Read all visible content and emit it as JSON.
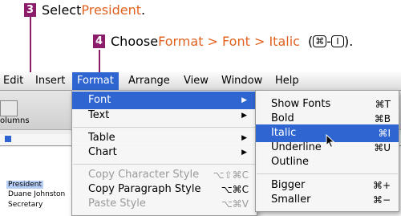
{
  "steps": {
    "step3": {
      "number": "3",
      "text": "Select ",
      "target": "President",
      "end": "."
    },
    "step4": {
      "number": "4",
      "text": "Choose ",
      "path": "Format > Font > Italic",
      "open_paren": "(",
      "key1": "⌘",
      "dash": "-",
      "key2": "I",
      "close": ")."
    }
  },
  "menubar": [
    "Edit",
    "Insert",
    "Format",
    "Arrange",
    "View",
    "Window",
    "Help"
  ],
  "document": {
    "toolbar_label": "olumns",
    "lines": [
      "President",
      "Duane Johnston",
      "Secretary"
    ]
  },
  "format_menu": [
    {
      "label": "Font",
      "arrow": "▶"
    },
    {
      "label": "Text",
      "arrow": "▶"
    },
    {
      "label": "Table",
      "arrow": "▶"
    },
    {
      "label": "Chart",
      "arrow": "▶"
    },
    {
      "label": "Copy Character Style",
      "shortcut": "⌥⇧⌘C"
    },
    {
      "label": "Copy Paragraph Style",
      "shortcut": "⌥⌘C"
    },
    {
      "label": "Paste Style",
      "shortcut": "⌥⌘V"
    }
  ],
  "font_submenu": [
    {
      "label": "Show Fonts",
      "shortcut": "⌘T"
    },
    {
      "label": "Bold",
      "shortcut": "⌘B"
    },
    {
      "label": "Italic",
      "shortcut": "⌘I"
    },
    {
      "label": "Underline",
      "shortcut": "⌘U"
    },
    {
      "label": "Outline"
    },
    {
      "label": "Bigger",
      "shortcut": "⌘+"
    },
    {
      "label": "Smaller",
      "shortcut": "⌘−"
    }
  ],
  "colors": {
    "badge": "#8b1d6b",
    "accent": "#e0621e",
    "highlight": "#2f65d1"
  }
}
